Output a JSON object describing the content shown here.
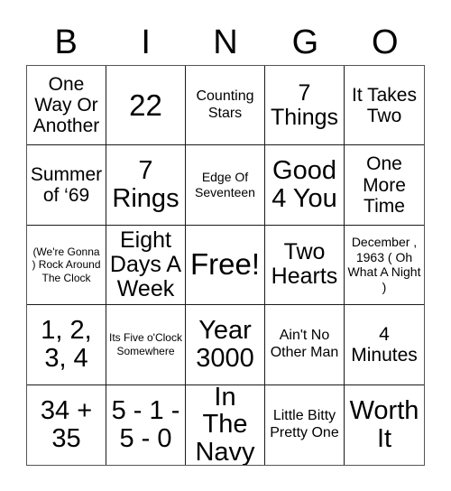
{
  "card": {
    "title": "BINGO",
    "header_letters": [
      "B",
      "I",
      "N",
      "G",
      "O"
    ],
    "free_space_label": "Free!",
    "rows": [
      [
        {
          "label": "One Way Or Another",
          "size": "lg"
        },
        {
          "label": "22",
          "size": "huge"
        },
        {
          "label": "Counting Stars",
          "size": "md"
        },
        {
          "label": "7 Things",
          "size": "xl"
        },
        {
          "label": "It Takes Two",
          "size": "lg"
        }
      ],
      [
        {
          "label": "Summer of ‘69",
          "size": "lg"
        },
        {
          "label": "7 Rings",
          "size": "xxl"
        },
        {
          "label": "Edge Of Seventeen",
          "size": "sm"
        },
        {
          "label": "Good 4 You",
          "size": "xxl"
        },
        {
          "label": "One More Time",
          "size": "lg"
        }
      ],
      [
        {
          "label": "(We're Gonna ) Rock Around The Clock",
          "size": "xs"
        },
        {
          "label": "Eight Days A Week",
          "size": "xl"
        },
        {
          "label": "Free!",
          "size": "huge"
        },
        {
          "label": "Two Hearts",
          "size": "xl"
        },
        {
          "label": "December , 1963 ( Oh What A Night )",
          "size": "sm"
        }
      ],
      [
        {
          "label": "1, 2, 3, 4",
          "size": "xxl"
        },
        {
          "label": "Its Five o'Clock Somewhere",
          "size": "xs"
        },
        {
          "label": "Year 3000",
          "size": "xxl"
        },
        {
          "label": "Ain't No Other Man",
          "size": "md"
        },
        {
          "label": "4 Minutes",
          "size": "lg"
        }
      ],
      [
        {
          "label": "34 + 35",
          "size": "xxl"
        },
        {
          "label": "5 - 1 - 5 - 0",
          "size": "xxl"
        },
        {
          "label": "In The Navy",
          "size": "xxl"
        },
        {
          "label": "Little Bitty Pretty One",
          "size": "md"
        },
        {
          "label": "Worth It",
          "size": "xxl"
        }
      ]
    ]
  },
  "colors": {
    "background": "#ffffff",
    "text": "#000000",
    "grid_line": "#1a1a1a",
    "outer_border": "#555555"
  }
}
